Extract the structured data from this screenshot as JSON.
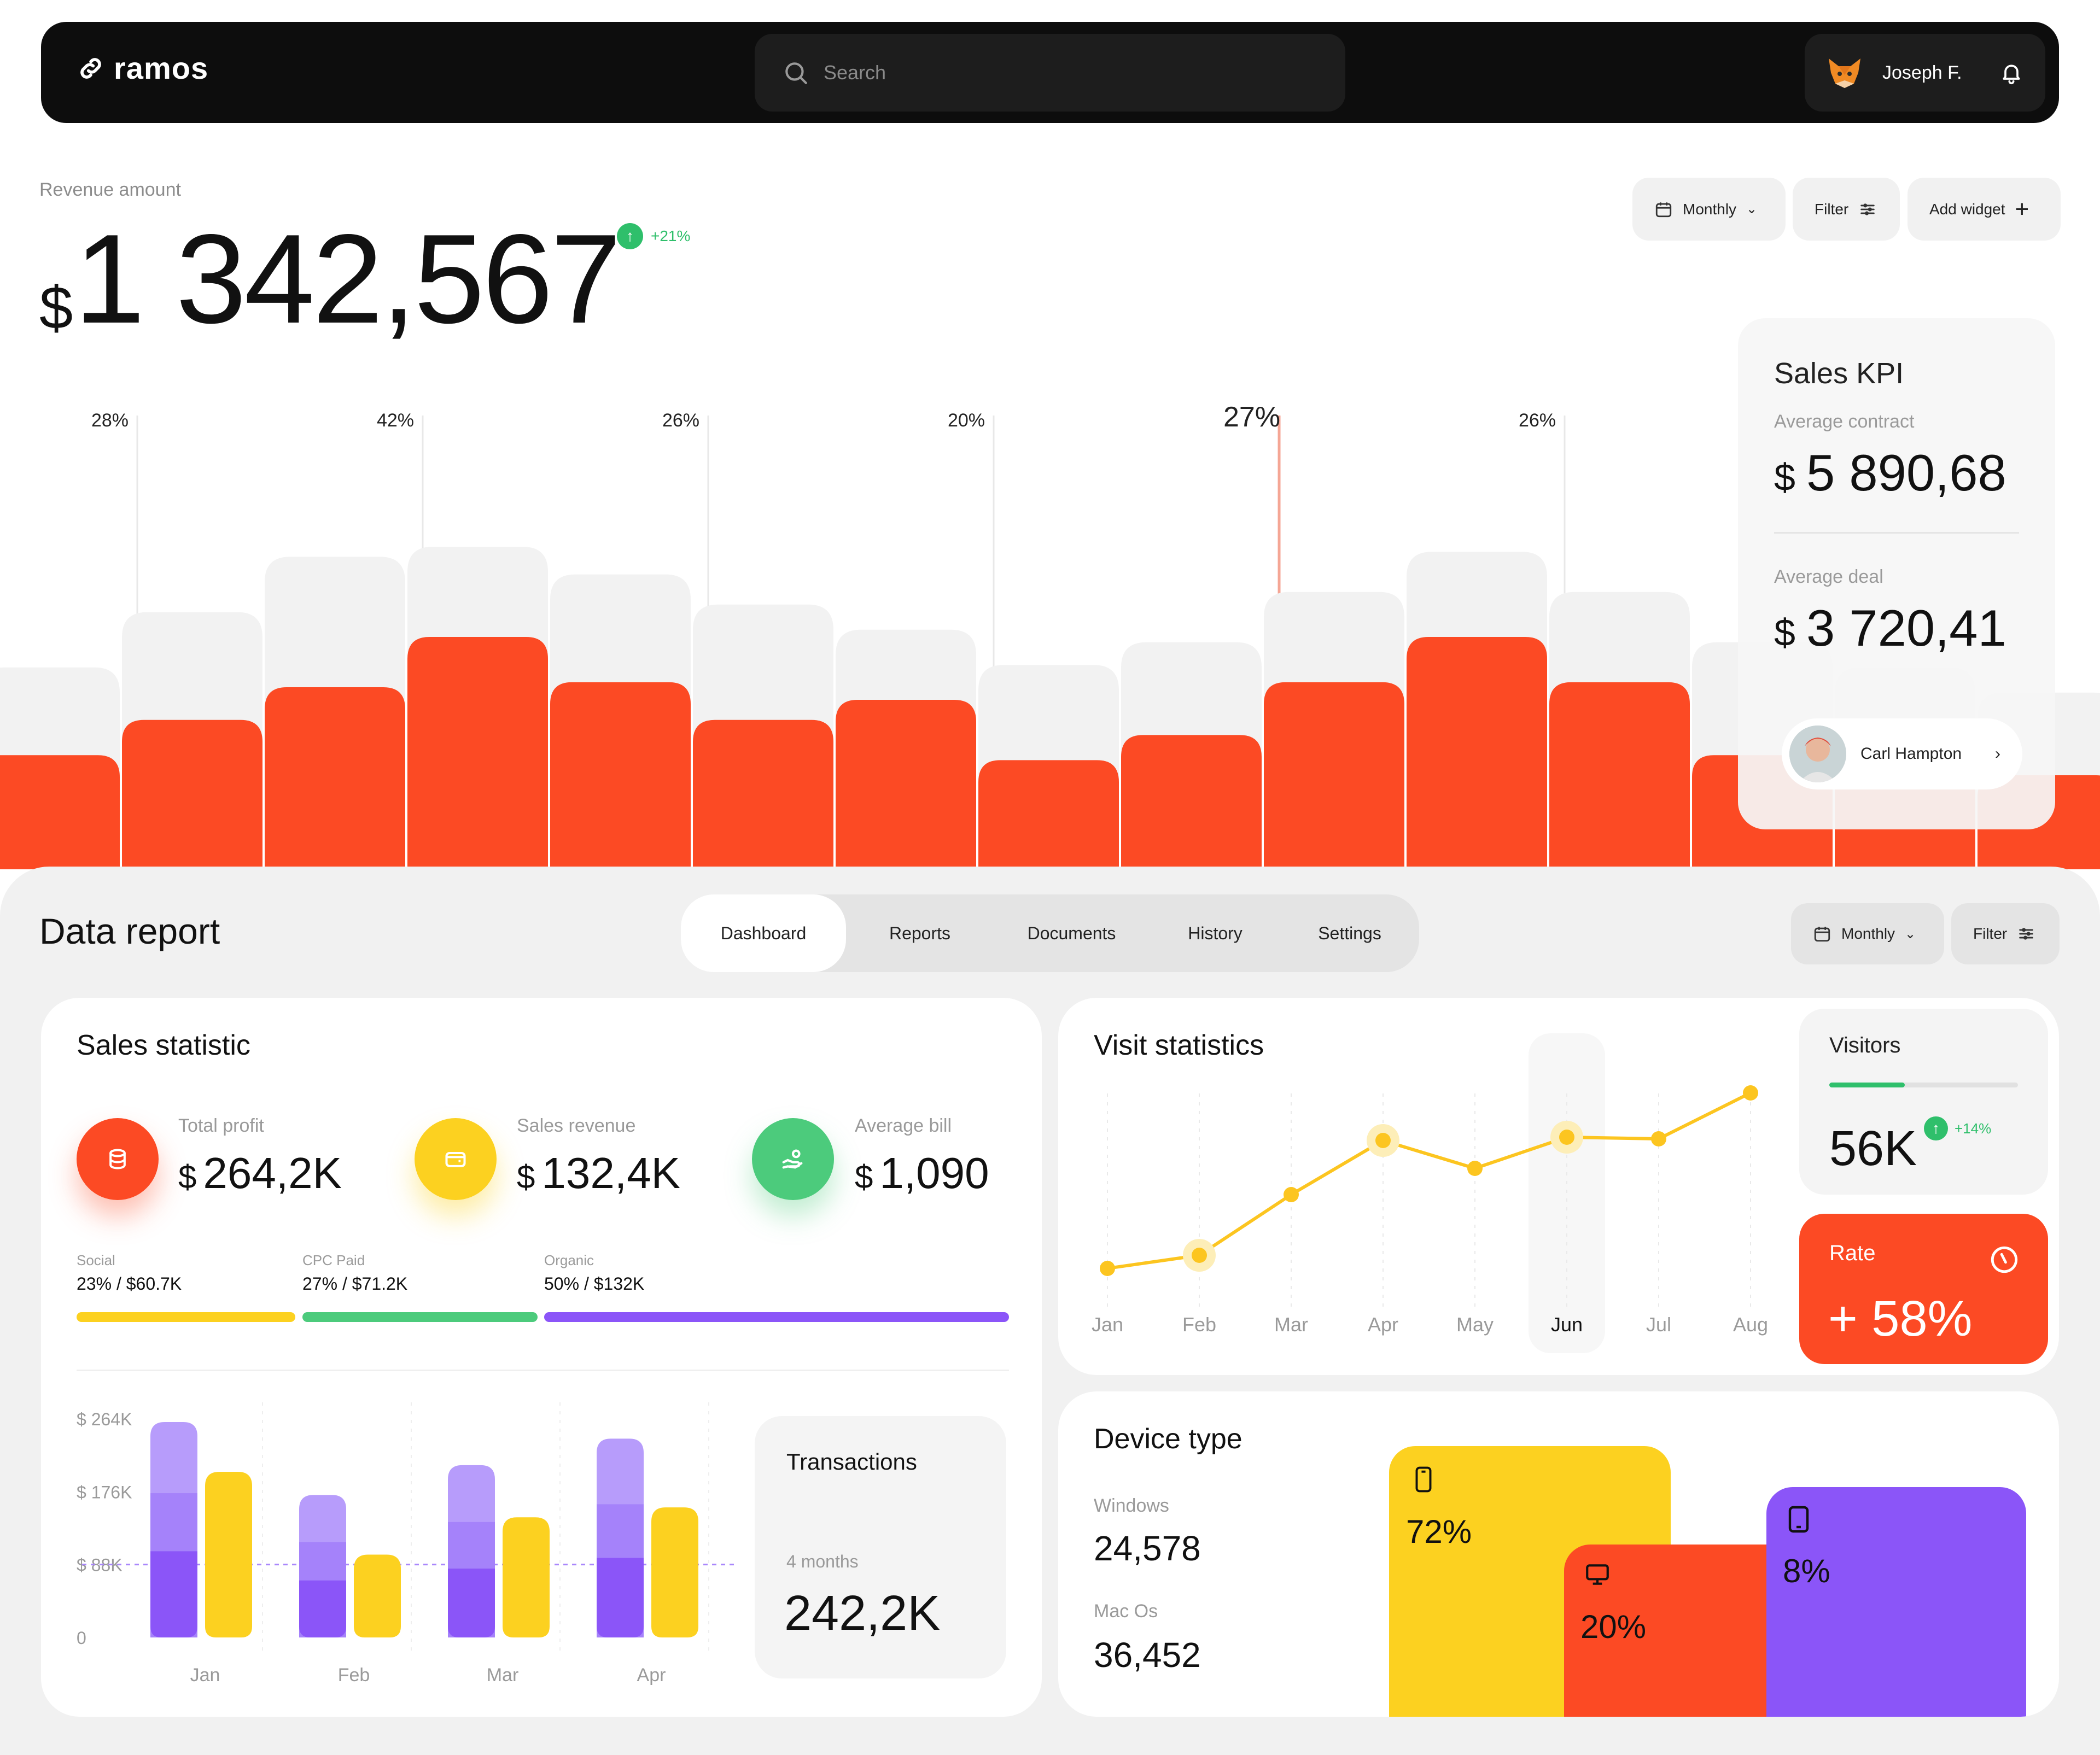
{
  "header": {
    "logo_text": "ramos",
    "search_placeholder": "Search",
    "user_name": "Joseph F."
  },
  "revenue": {
    "label": "Revenue amount",
    "currency": "$",
    "amount": "1 342,567",
    "change": "+21%",
    "controls": {
      "monthly": "Monthly",
      "filter": "Filter",
      "add_widget": "Add widget"
    }
  },
  "chart_data": [
    {
      "type": "bar",
      "name": "revenue-bars",
      "percent_labels": [
        {
          "text": "28%",
          "col": 1
        },
        {
          "text": "42%",
          "col": 3
        },
        {
          "text": "26%",
          "col": 5
        },
        {
          "text": "20%",
          "col": 7
        },
        {
          "text": "27%",
          "col": 9,
          "highlight": true
        },
        {
          "text": "26%",
          "col": 11
        }
      ],
      "values": [
        28,
        42,
        55,
        75,
        57,
        42,
        50,
        26,
        36,
        57,
        75,
        57,
        28,
        33,
        20
      ],
      "background_values": [
        52,
        74,
        96,
        110,
        89,
        77,
        67,
        53,
        62,
        82,
        98,
        82,
        62,
        52,
        42
      ]
    },
    {
      "type": "line",
      "name": "visit-statistics",
      "categories": [
        "Jan",
        "Feb",
        "Mar",
        "Apr",
        "May",
        "Jun",
        "Jul",
        "Aug"
      ],
      "values": [
        10,
        18,
        55,
        88,
        71,
        90,
        89,
        117
      ],
      "highlight": "Jun"
    },
    {
      "type": "bar",
      "name": "monthly-sales",
      "categories": [
        "Jan",
        "Feb",
        "Mar",
        "Apr"
      ],
      "yticks": [
        "$ 264K",
        "$ 176K",
        "$ 88K",
        "0"
      ],
      "series": [
        {
          "values": [
            260,
            172,
            208,
            240
          ]
        },
        {
          "values": [
            200,
            100,
            145,
            157
          ]
        }
      ],
      "ylim": [
        0,
        264
      ]
    },
    {
      "type": "bar",
      "name": "device-type",
      "values": [
        72,
        20,
        8
      ],
      "labels": [
        "72%",
        "20%",
        "8%"
      ]
    }
  ],
  "kpi": {
    "title": "Sales KPI",
    "contract_label": "Average contract",
    "contract_currency": "$",
    "contract_value": "5 890,68",
    "deal_label": "Average deal",
    "deal_currency": "$",
    "deal_value": "3 720,41",
    "person_name": "Carl Hampton"
  },
  "report": {
    "title": "Data report",
    "tabs": [
      "Dashboard",
      "Reports",
      "Documents",
      "History",
      "Settings"
    ],
    "monthly": "Monthly",
    "filter": "Filter"
  },
  "sales": {
    "title": "Sales statistic",
    "stats": [
      {
        "label": "Total profit",
        "currency": "$",
        "value": "264,2K",
        "color": "#fc4a24"
      },
      {
        "label": "Sales revenue",
        "currency": "$",
        "value": "132,4K",
        "color": "#fcd120"
      },
      {
        "label": "Average bill",
        "currency": "$",
        "value": "1,090",
        "color": "#4ccb7c"
      }
    ],
    "channels": [
      {
        "name": "Social",
        "value": "23% / $60.7K",
        "color": "#fcd120",
        "fraction": 0.23
      },
      {
        "name": "CPC Paid",
        "value": "27% / $71.2K",
        "color": "#4ccb7c",
        "fraction": 0.27
      },
      {
        "name": "Organic",
        "value": "50% / $132K",
        "color": "#8b55f8",
        "fraction": 0.5
      }
    ],
    "transactions_title": "Transactions",
    "transactions_period": "4 months",
    "transactions_value": "242,2K"
  },
  "visits": {
    "title": "Visit statistics",
    "visitors_label": "Visitors",
    "visitors_value": "56K",
    "visitors_change": "+14%",
    "visitors_progress": 0.4,
    "rate_label": "Rate",
    "rate_value": "+ 58%"
  },
  "device": {
    "title": "Device type",
    "windows_label": "Windows",
    "windows_value": "24,578",
    "mac_label": "Mac Os",
    "mac_value": "36,452"
  },
  "colors": {
    "orange": "#fc4a24",
    "yellow": "#fcd120",
    "green": "#4ccb7c",
    "purple": "#8b55f8"
  }
}
